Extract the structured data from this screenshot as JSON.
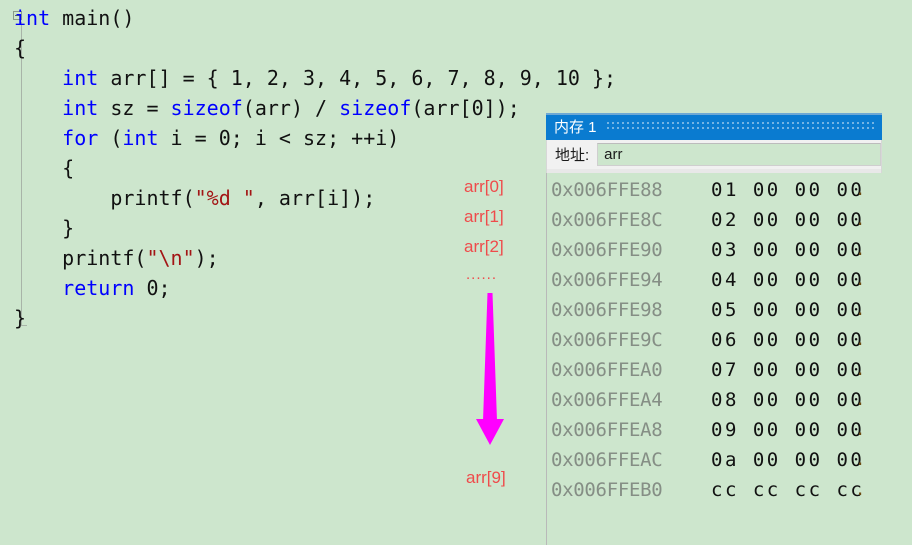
{
  "editor": {
    "background_color": "#cde6cd",
    "fold_marker": "collapse-minus",
    "lines": [
      {
        "segments": [
          {
            "t": "int",
            "c": "kw"
          },
          {
            "t": " main()",
            "c": "plain"
          }
        ]
      },
      {
        "segments": [
          {
            "t": "{",
            "c": "plain"
          }
        ]
      },
      {
        "segments": [
          {
            "t": "    ",
            "c": "plain"
          },
          {
            "t": "int",
            "c": "kw"
          },
          {
            "t": " arr[] = { 1, 2, 3, 4, 5, 6, 7, 8, 9, 10 };",
            "c": "plain"
          }
        ]
      },
      {
        "segments": [
          {
            "t": "    ",
            "c": "plain"
          },
          {
            "t": "int",
            "c": "kw"
          },
          {
            "t": " sz = ",
            "c": "plain"
          },
          {
            "t": "sizeof",
            "c": "kw"
          },
          {
            "t": "(arr) / ",
            "c": "plain"
          },
          {
            "t": "sizeof",
            "c": "kw"
          },
          {
            "t": "(arr[0]);",
            "c": "plain"
          }
        ]
      },
      {
        "segments": [
          {
            "t": "    ",
            "c": "plain"
          },
          {
            "t": "for",
            "c": "kw"
          },
          {
            "t": " (",
            "c": "plain"
          },
          {
            "t": "int",
            "c": "kw"
          },
          {
            "t": " i = 0; i < sz; ++i)",
            "c": "plain"
          }
        ]
      },
      {
        "segments": [
          {
            "t": "    {",
            "c": "plain"
          }
        ]
      },
      {
        "segments": [
          {
            "t": "        printf(",
            "c": "plain"
          },
          {
            "t": "\"%d \"",
            "c": "str"
          },
          {
            "t": ", arr[i]);",
            "c": "plain"
          }
        ]
      },
      {
        "segments": [
          {
            "t": "    }",
            "c": "plain"
          }
        ]
      },
      {
        "segments": [
          {
            "t": "    printf(",
            "c": "plain"
          },
          {
            "t": "\"\\n\"",
            "c": "str"
          },
          {
            "t": ");",
            "c": "plain"
          }
        ]
      },
      {
        "segments": [
          {
            "t": "    ",
            "c": "plain"
          },
          {
            "t": "return",
            "c": "kw"
          },
          {
            "t": " 0;",
            "c": "plain"
          }
        ]
      },
      {
        "segments": [
          {
            "t": "}",
            "c": "plain"
          }
        ]
      }
    ]
  },
  "annotations": {
    "color": "#ef4b4b",
    "arrow_color": "#ff00ff",
    "labels": {
      "arr0": "arr[0]",
      "arr1": "arr[1]",
      "arr2": "arr[2]",
      "ellipsis": "......",
      "arr9": "arr[9]"
    }
  },
  "memory_window": {
    "title": "内存 1",
    "title_bar_color": "#0a7bd0",
    "address_label": "地址:",
    "address_value": "arr",
    "address_placeholder": "arr",
    "rows": [
      {
        "address": "0x006FFE88",
        "bytes": "01 00 00 00",
        "ascii": "."
      },
      {
        "address": "0x006FFE8C",
        "bytes": "02 00 00 00",
        "ascii": "."
      },
      {
        "address": "0x006FFE90",
        "bytes": "03 00 00 00",
        "ascii": "."
      },
      {
        "address": "0x006FFE94",
        "bytes": "04 00 00 00",
        "ascii": "."
      },
      {
        "address": "0x006FFE98",
        "bytes": "05 00 00 00",
        "ascii": "."
      },
      {
        "address": "0x006FFE9C",
        "bytes": "06 00 00 00",
        "ascii": "."
      },
      {
        "address": "0x006FFEA0",
        "bytes": "07 00 00 00",
        "ascii": "."
      },
      {
        "address": "0x006FFEA4",
        "bytes": "08 00 00 00",
        "ascii": "."
      },
      {
        "address": "0x006FFEA8",
        "bytes": "09 00 00 00",
        "ascii": "."
      },
      {
        "address": "0x006FFEAC",
        "bytes": "0a 00 00 00",
        "ascii": "."
      },
      {
        "address": "0x006FFEB0",
        "bytes": "cc cc cc cc",
        "ascii": "."
      }
    ]
  }
}
